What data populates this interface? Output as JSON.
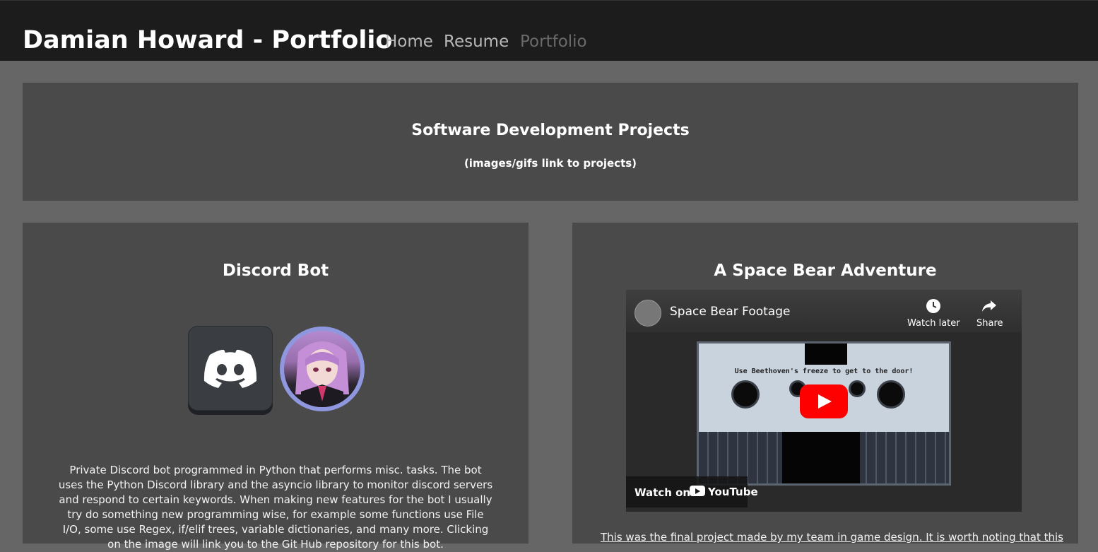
{
  "navbar": {
    "brand": "Damian Howard - Portfolio",
    "links": [
      {
        "label": "Home"
      },
      {
        "label": "Resume"
      },
      {
        "label": "Portfolio"
      }
    ]
  },
  "header": {
    "title": "Software Development Projects",
    "subtitle": "(images/gifs link to projects)"
  },
  "cards": [
    {
      "title": "Discord Bot",
      "text": "Private Discord bot programmed in Python that performs misc. tasks. The bot uses the Python Discord library and the asyncio library to monitor discord servers and respond to certain keywords. When making new features for the bot I usually try do something new programming wise, for example some functions use File I/O, some use Regex, if/elif trees, variable dictionaries, and many more. Clicking on the image will link you to the Git Hub repository for this bot."
    },
    {
      "title": "A Space Bear Adventure",
      "video": {
        "title": "Space Bear Footage",
        "watch_later": "Watch later",
        "share": "Share",
        "game_caption": "Use Beethoven's freeze to get to the door!",
        "watch_on": "Watch on",
        "youtube": "YouTube"
      },
      "text": "This was the final project made by my team in game design. It is worth noting that this"
    }
  ],
  "colors": {
    "background": "#666666",
    "navbar": "#1c1c1c",
    "panel": "#4a4a4a",
    "youtube_red": "#ff0000"
  }
}
